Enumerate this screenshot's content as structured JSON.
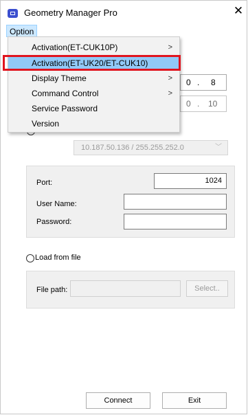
{
  "window": {
    "title": "Geometry Manager Pro",
    "close_glyph": "✕"
  },
  "menubar": {
    "option_label": "Option"
  },
  "menu": {
    "items": [
      {
        "label": "Activation(ET-CUK10P)",
        "has_submenu": true,
        "arrow": ">"
      },
      {
        "label": "Activation(ET-UK20/ET-CUK10)",
        "has_submenu": false,
        "arrow": ""
      },
      {
        "label": "Display Theme",
        "has_submenu": true,
        "arrow": ">"
      },
      {
        "label": "Command Control",
        "has_submenu": true,
        "arrow": ">"
      },
      {
        "label": "Service Password",
        "has_submenu": false,
        "arrow": ""
      },
      {
        "label": "Version",
        "has_submenu": false,
        "arrow": ""
      }
    ],
    "highlighted_index": 1
  },
  "ip_fields": {
    "row1": {
      "seg1": "0",
      "dot": ".",
      "seg2": "8"
    },
    "row2": {
      "seg1": "0",
      "dot": ".",
      "seg2": "10"
    }
  },
  "network": {
    "interface_value": "10.187.50.136 / 255.255.252.0"
  },
  "connection": {
    "port_label": "Port:",
    "port_value": "1024",
    "username_label": "User Name:",
    "username_value": "",
    "password_label": "Password:",
    "password_value": ""
  },
  "load_from_file": {
    "radio_label": "Load from file",
    "filepath_label": "File path:",
    "filepath_value": "",
    "select_label": "Select.."
  },
  "buttons": {
    "connect": "Connect",
    "exit": "Exit"
  },
  "colors": {
    "highlight": "#91c9f7",
    "annotation": "#e0141e",
    "menubar_active": "#cce8ff"
  }
}
